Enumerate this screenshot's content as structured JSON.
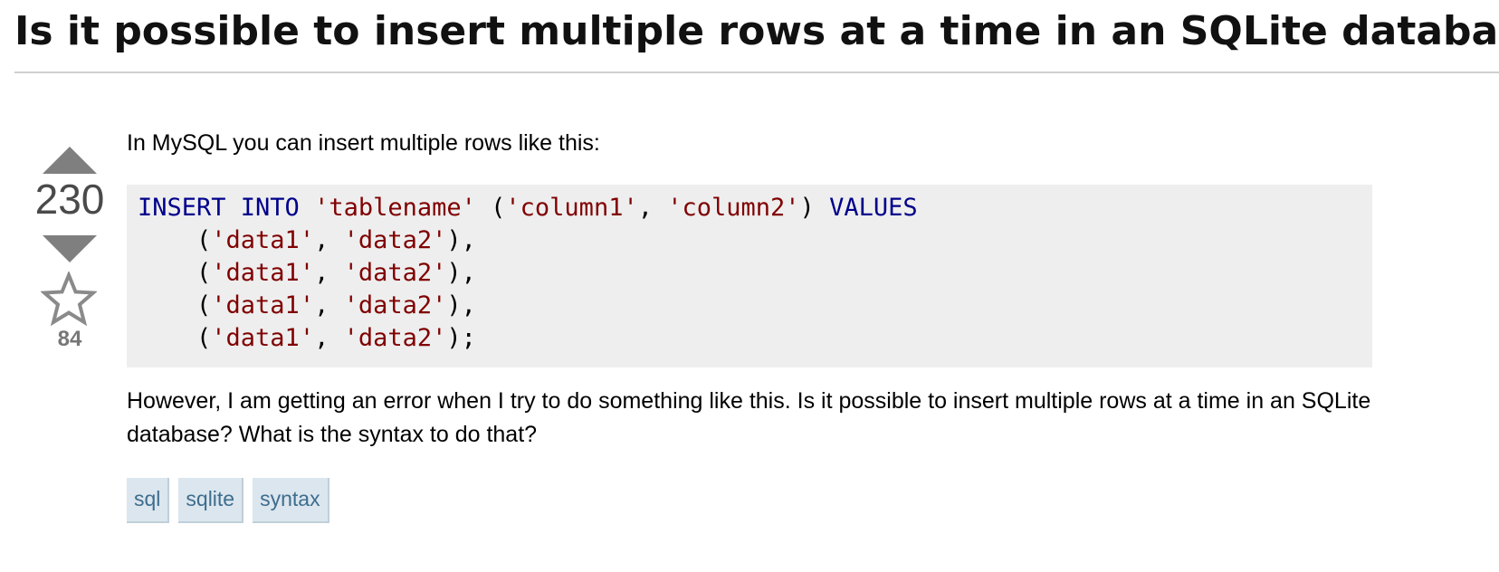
{
  "question": {
    "title": "Is it possible to insert multiple rows at a time in an SQLite database?"
  },
  "votes": {
    "score": "230",
    "favorite_count": "84",
    "icons": [
      "upvote-arrow-icon",
      "downvote-arrow-icon",
      "favorite-star-icon"
    ]
  },
  "body": {
    "intro": "In MySQL you can insert multiple rows like this:",
    "code": {
      "line1": {
        "kw1": "INSERT INTO",
        "sp1": " ",
        "str1": "'tablename'",
        "p1": " (",
        "str2": "'column1'",
        "p2": ", ",
        "str3": "'column2'",
        "p3": ") ",
        "kw2": "VALUES"
      },
      "rows": [
        {
          "open": "    (",
          "a": "'data1'",
          "sep": ", ",
          "b": "'data2'",
          "close": "),"
        },
        {
          "open": "    (",
          "a": "'data1'",
          "sep": ", ",
          "b": "'data2'",
          "close": "),"
        },
        {
          "open": "    (",
          "a": "'data1'",
          "sep": ", ",
          "b": "'data2'",
          "close": "),"
        },
        {
          "open": "    (",
          "a": "'data1'",
          "sep": ", ",
          "b": "'data2'",
          "close": ");"
        }
      ]
    },
    "followup": "However, I am getting an error when I try to do something like this. Is it possible to insert multiple rows at a time in an SQLite database? What is the syntax to do that?"
  },
  "tags": [
    "sql",
    "sqlite",
    "syntax"
  ],
  "colors": {
    "keyword": "#00008b",
    "string": "#800000",
    "code_background": "#eeeeee",
    "tag_background": "#dbe6ee",
    "tag_text": "#3e6d8e"
  }
}
